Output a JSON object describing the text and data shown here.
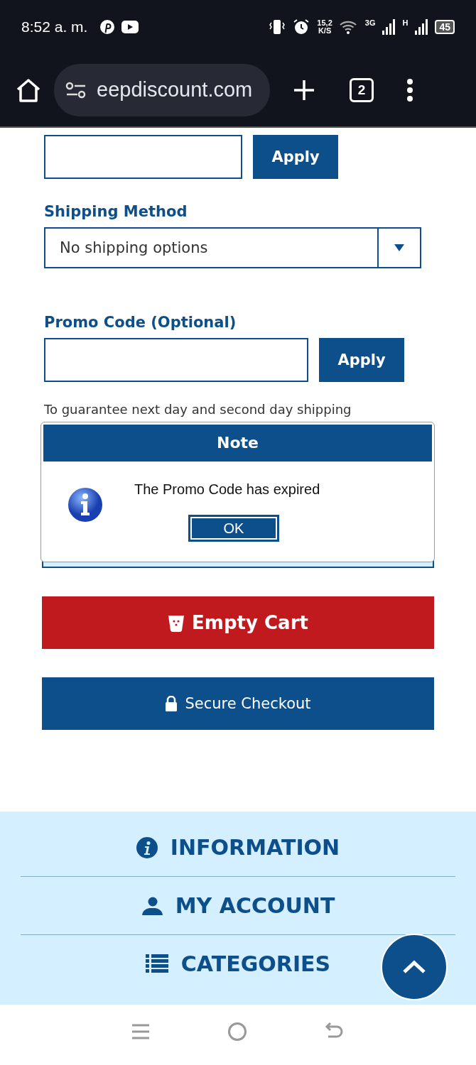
{
  "status_bar": {
    "time": "8:52 a. m.",
    "speed": "15,2",
    "speed_unit": "K/S",
    "network_1": "3G",
    "network_2": "H",
    "battery": "45"
  },
  "browser": {
    "url": "eepdiscount.com",
    "tab_count": "2"
  },
  "coupon": {
    "apply": "Apply"
  },
  "shipping": {
    "label": "Shipping Method",
    "value": "No shipping options"
  },
  "promo": {
    "label": "Promo Code (Optional)",
    "apply": "Apply"
  },
  "notice": "To guarantee next day and second day shipping",
  "dialog": {
    "title": "Note",
    "message": "The Promo Code has expired",
    "ok": "OK"
  },
  "buttons": [
    {
      "kind": "danger",
      "label": "Empty Cart"
    },
    {
      "kind": "primary",
      "label": "Secure Checkout"
    }
  ],
  "footer": [
    {
      "kind": "info",
      "label": "INFORMATION"
    },
    {
      "kind": "account",
      "label": "MY ACCOUNT"
    },
    {
      "kind": "list",
      "label": "CATEGORIES"
    }
  ]
}
